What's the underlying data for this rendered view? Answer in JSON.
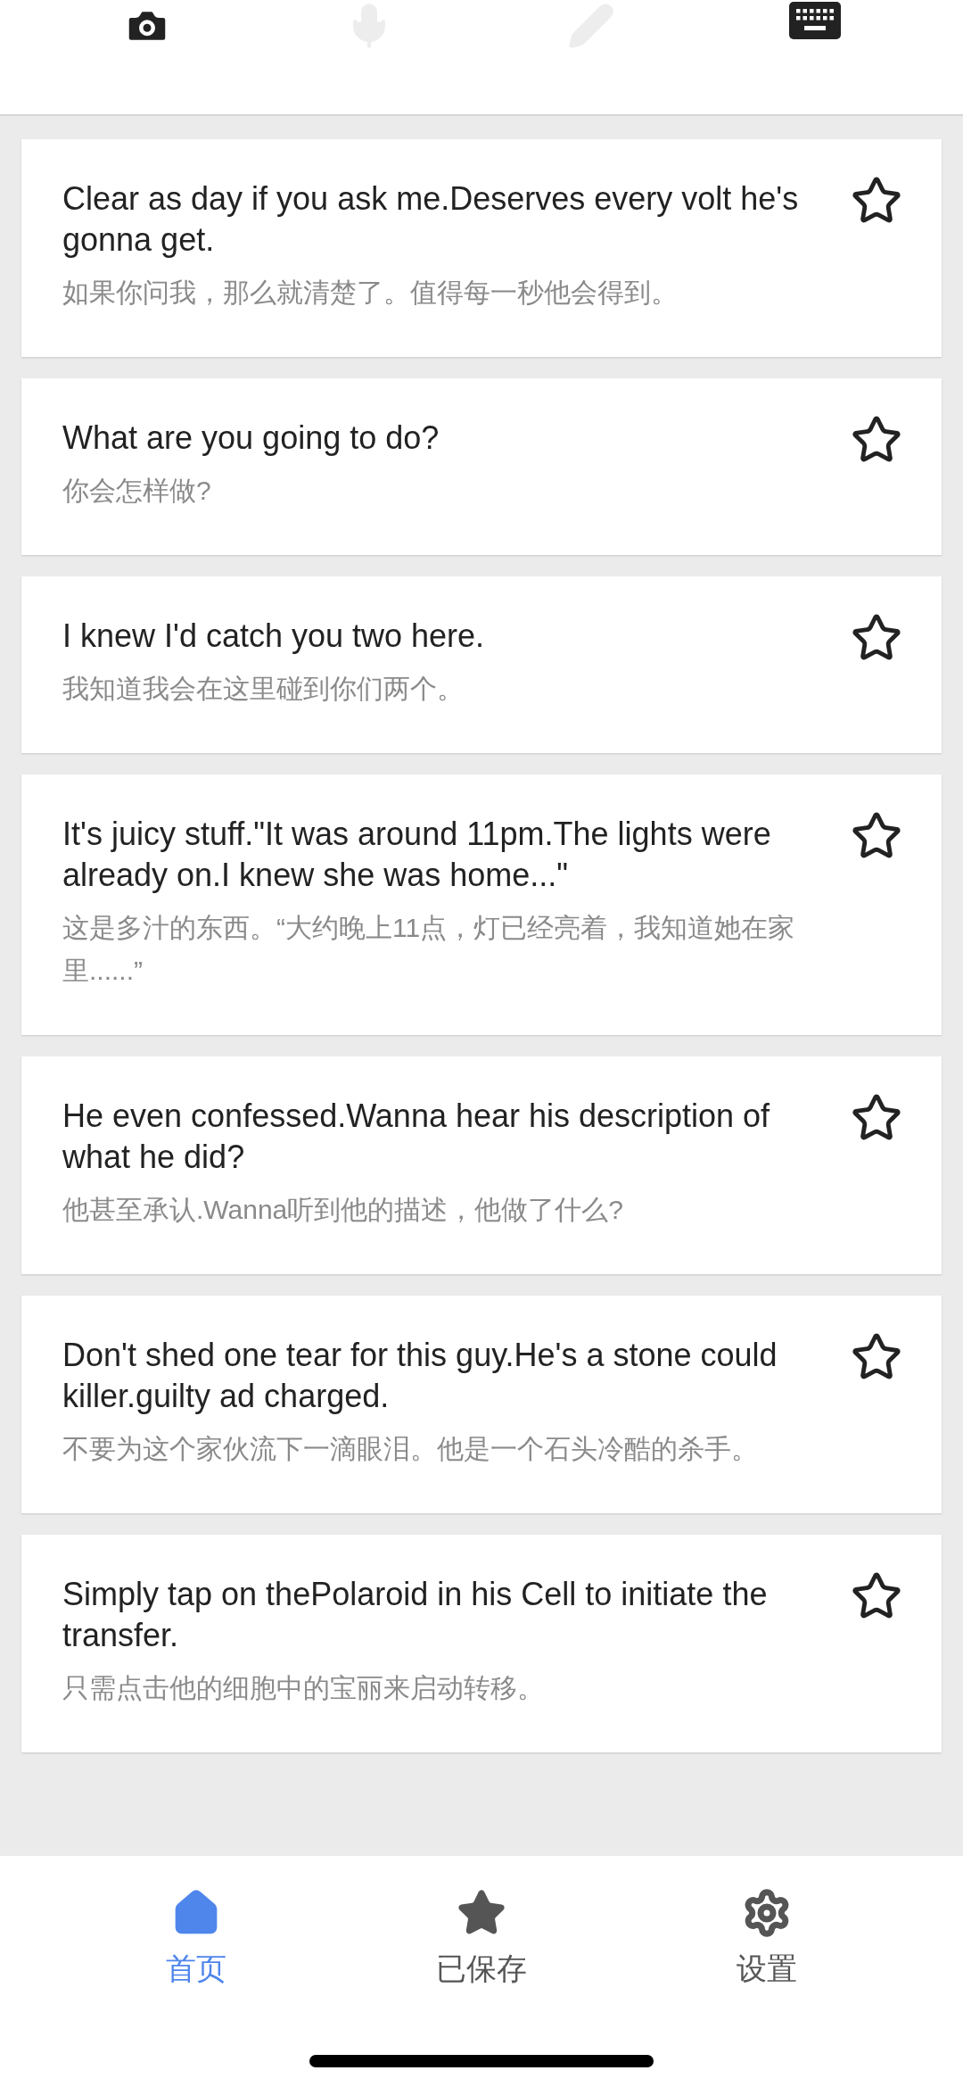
{
  "input_modes": [
    {
      "kind": "camera",
      "disabled": false
    },
    {
      "kind": "microphone",
      "disabled": true
    },
    {
      "kind": "pen",
      "disabled": true
    },
    {
      "kind": "keyboard",
      "disabled": false
    }
  ],
  "phrases": [
    {
      "english": "Clear as day if you ask me.Deserves every volt he's gonna get.",
      "chinese": "如果你问我，那么就清楚了。值得每一秒他会得到。",
      "starred": false
    },
    {
      "english": "What are you going to do?",
      "chinese": "你会怎样做?",
      "starred": false
    },
    {
      "english": "I knew I'd catch you two here.",
      "chinese": "我知道我会在这里碰到你们两个。",
      "starred": false
    },
    {
      "english": "It's juicy stuff.\"It was around 11pm.The lights were already on.I knew she was home...\"",
      "chinese": "这是多汁的东西。“大约晚上11点，灯已经亮着，我知道她在家里......”",
      "starred": false
    },
    {
      "english": "He even confessed.Wanna hear his description of what he did?",
      "chinese": "他甚至承认.Wanna听到他的描述，他做了什么?",
      "starred": false
    },
    {
      "english": "Don't shed one tear for this guy.He's a stone could killer.guilty ad charged.",
      "chinese": "不要为这个家伙流下一滴眼泪。他是一个石头冷酷的杀手。",
      "starred": false
    },
    {
      "english": "Simply tap on thePolaroid in his Cell to initiate the transfer.",
      "chinese": "只需点击他的细胞中的宝丽来启动转移。",
      "starred": false
    }
  ],
  "tab_bar": [
    {
      "kind": "home",
      "label": "首页",
      "selected": true
    },
    {
      "kind": "saved",
      "label": "已保存",
      "selected": false
    },
    {
      "kind": "settings",
      "label": "设置",
      "selected": false
    }
  ]
}
